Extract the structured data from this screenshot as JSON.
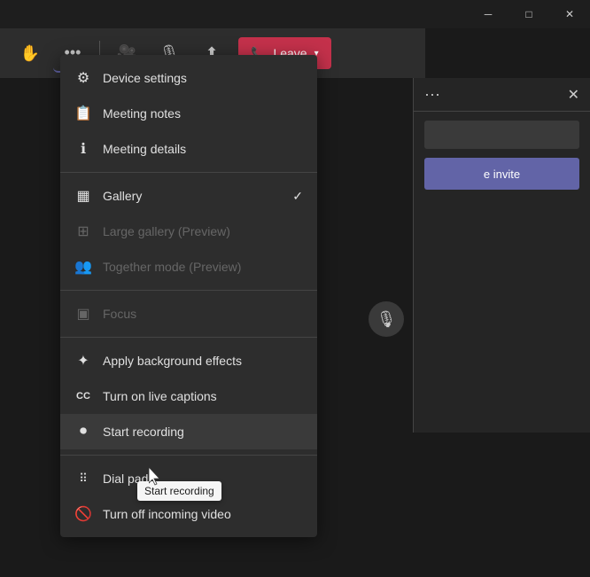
{
  "titleBar": {
    "minimizeLabel": "─",
    "maximizeLabel": "□",
    "closeLabel": "✕"
  },
  "toolbar": {
    "handIcon": "🖐",
    "moreIcon": "•••",
    "videoIcon": "📷",
    "micIcon": "🎙",
    "shareIcon": "⬆",
    "leaveLabel": "Leave"
  },
  "menu": {
    "items": [
      {
        "id": "device-settings",
        "icon": "⚙",
        "label": "Device settings",
        "disabled": false
      },
      {
        "id": "meeting-notes",
        "icon": "📋",
        "label": "Meeting notes",
        "disabled": false
      },
      {
        "id": "meeting-details",
        "icon": "ℹ",
        "label": "Meeting details",
        "disabled": false
      },
      {
        "id": "divider1"
      },
      {
        "id": "gallery",
        "icon": "▦",
        "label": "Gallery",
        "check": "✓",
        "disabled": false
      },
      {
        "id": "large-gallery",
        "icon": "⊞",
        "label": "Large gallery (Preview)",
        "disabled": true
      },
      {
        "id": "together-mode",
        "icon": "👥",
        "label": "Together mode (Preview)",
        "disabled": true
      },
      {
        "id": "divider2"
      },
      {
        "id": "focus",
        "icon": "▣",
        "label": "Focus",
        "disabled": true
      },
      {
        "id": "divider3"
      },
      {
        "id": "background",
        "icon": "✦",
        "label": "Apply background effects",
        "disabled": false
      },
      {
        "id": "captions",
        "icon": "CC",
        "label": "Turn on live captions",
        "disabled": false
      },
      {
        "id": "recording",
        "icon": "⏺",
        "label": "Start recording",
        "disabled": false,
        "active": true
      },
      {
        "id": "divider4"
      },
      {
        "id": "dialpad",
        "icon": "⠿",
        "label": "Dial pad",
        "disabled": false
      },
      {
        "id": "incoming-video",
        "icon": "📵",
        "label": "Turn off incoming video",
        "disabled": false
      }
    ]
  },
  "sidePanel": {
    "dotsLabel": "···",
    "closeLabel": "✕",
    "inviteLabel": "e invite"
  },
  "tooltip": {
    "label": "Start recording"
  }
}
